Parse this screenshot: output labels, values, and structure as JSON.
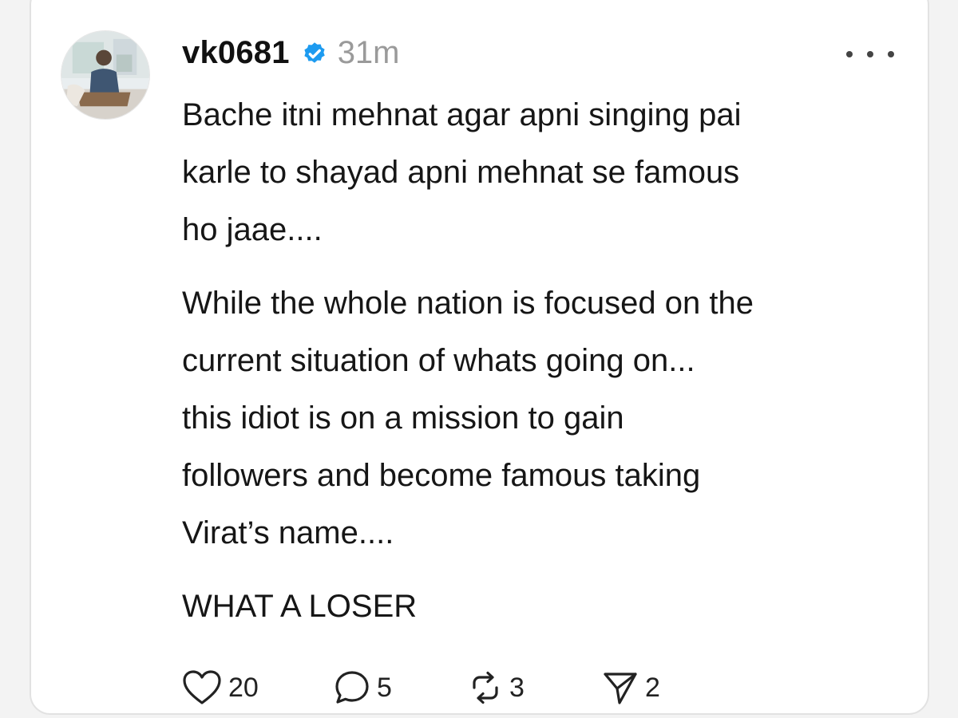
{
  "post": {
    "username": "vk0681",
    "timestamp": "31m",
    "paragraphs": [
      "Bache itni mehnat agar apni singing pai\nkarle to shayad apni mehnat se famous\nho jaae....",
      "While the whole nation is focused on the\ncurrent situation of whats going on...\nthis idiot is on a mission to gain\nfollowers and become famous taking\nVirat’s name....",
      "WHAT A LOSER"
    ]
  },
  "actions": {
    "likes": "20",
    "comments": "5",
    "reposts": "3",
    "shares": "2"
  },
  "icons": {
    "verified": "verified-badge-icon",
    "more": "more-options-icon",
    "like": "heart-icon",
    "comment": "comment-bubble-icon",
    "repost": "repost-arrows-icon",
    "share": "send-paper-plane-icon"
  },
  "colors": {
    "verified_badge": "#1d9bf0",
    "username": "#111111",
    "timestamp": "#9a9a9a",
    "body_text": "#161616"
  }
}
